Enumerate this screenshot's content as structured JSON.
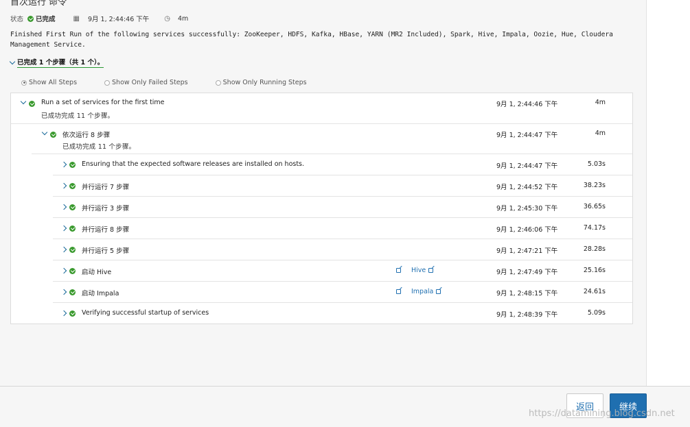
{
  "page": {
    "title": "首次运行 命令",
    "status_label": "状态",
    "status_value": "已完成",
    "date": "9月 1, 2:44:46 下午",
    "duration": "4m",
    "message": "Finished First Run of the following services successfully: ZooKeeper, HDFS, Kafka, HBase, YARN (MR2 Included), Spark, Hive, Impala, Oozie, Hue, Cloudera Management Service.",
    "summary": "已完成 1 个步骤（共 1 个）。"
  },
  "filters": [
    "Show All Steps",
    "Show Only Failed Steps",
    "Show Only Running Steps"
  ],
  "selected_filter": "Show All Steps",
  "steps": {
    "root": {
      "name": "Run a set of services for the first time",
      "sub": "已成功完成 11 个步骤。",
      "time": "9月 1, 2:44:46 下午",
      "duration": "4m"
    },
    "group": {
      "name": "依次运行 8 步骤",
      "sub": "已成功完成 11 个步骤。",
      "time": "9月 1, 2:44:47 下午",
      "duration": "4m"
    },
    "children": [
      {
        "name": "Ensuring that the expected software releases are installed on hosts.",
        "time": "9月 1, 2:44:47 下午",
        "duration": "5.03s",
        "role_link": "",
        "service_link": ""
      },
      {
        "name": "并行运行 7 步骤",
        "time": "9月 1, 2:44:52 下午",
        "duration": "38.23s",
        "role_link": "",
        "service_link": ""
      },
      {
        "name": "并行运行 3 步骤",
        "time": "9月 1, 2:45:30 下午",
        "duration": "36.65s",
        "role_link": "",
        "service_link": ""
      },
      {
        "name": "并行运行 8 步骤",
        "time": "9月 1, 2:46:06 下午",
        "duration": "74.17s",
        "role_link": "",
        "service_link": ""
      },
      {
        "name": "并行运行 5 步骤",
        "time": "9月 1, 2:47:21 下午",
        "duration": "28.28s",
        "role_link": "",
        "service_link": ""
      },
      {
        "name": "启动 Hive",
        "time": "9月 1, 2:47:49 下午",
        "duration": "25.16s",
        "role_link": "",
        "service_link": "Hive"
      },
      {
        "name": "启动 Impala",
        "time": "9月 1, 2:48:15 下午",
        "duration": "24.61s",
        "role_link": "",
        "service_link": "Impala"
      },
      {
        "name": "Verifying successful startup of services",
        "time": "9月 1, 2:48:39 下午",
        "duration": "5.09s",
        "role_link": "",
        "service_link": ""
      }
    ]
  },
  "footer": {
    "back_label": "返回",
    "next_label": "继续"
  },
  "watermark": "https://datamining.blog.csdn.net",
  "colors": {
    "success": "#3a9a2e",
    "link": "#1f6fb0",
    "primary_button": "#1f6fb0",
    "summary_underline": "#2a9a33"
  }
}
